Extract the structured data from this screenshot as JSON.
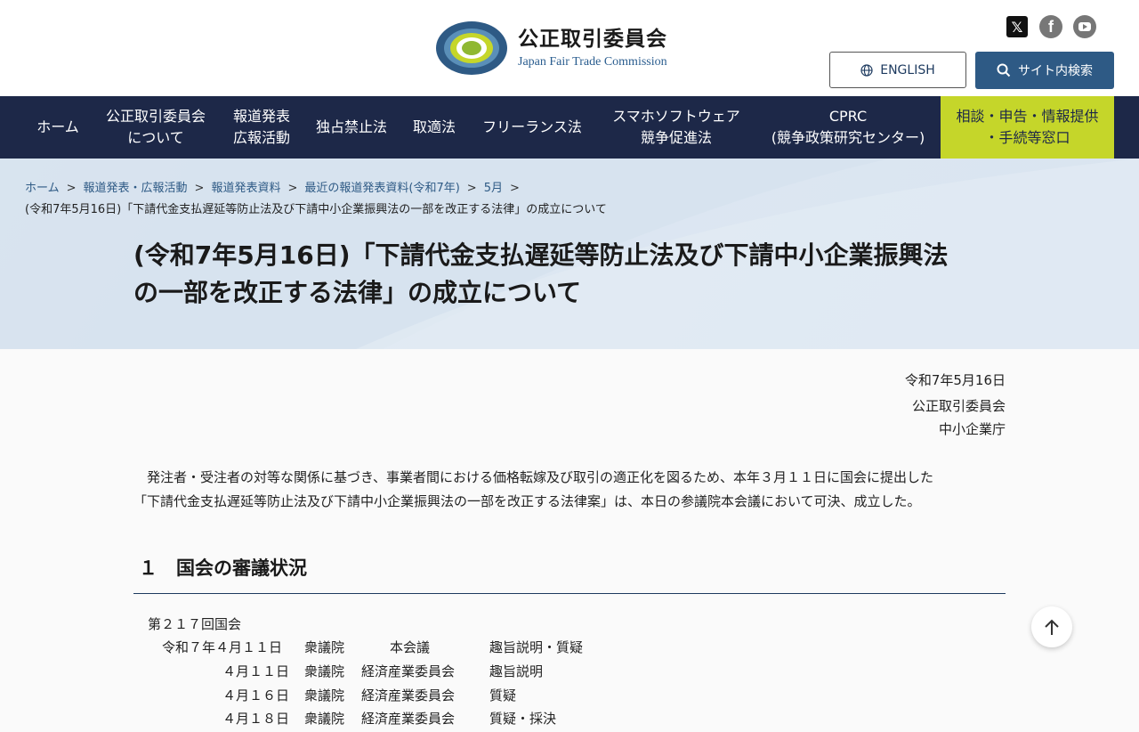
{
  "header": {
    "org_name_ja": "公正取引委員会",
    "org_name_en": "Japan Fair Trade Commission",
    "logo_ring_text": "JAPAN FAIR TRADE COMMISSION",
    "english_label": "ENGLISH",
    "search_label": "サイト内検索",
    "social": [
      "x-icon",
      "facebook-icon",
      "youtube-icon"
    ]
  },
  "nav": {
    "items": [
      "ホーム",
      "公正取引委員会\nについて",
      "報道発表\n広報活動",
      "独占禁止法",
      "取適法",
      "フリーランス法",
      "スマホソフトウェア\n競争促進法",
      "CPRC\n(競争政策研究センター)",
      "相談・申告・情報提供\n・手続等窓口"
    ]
  },
  "breadcrumb": {
    "items": [
      "ホーム",
      "報道発表・広報活動",
      "報道発表資料",
      "最近の報道発表資料(令和7年)",
      "5月"
    ],
    "separator": ">",
    "current": "(令和7年5月16日)「下請代金支払遅延等防止法及び下請中小企業振興法の一部を改正する法律」の成立について"
  },
  "page": {
    "title_line1": "(令和7年5月16日)「下請代金支払遅延等防止法及び下請中小企業振興法",
    "title_line2": "の一部を改正する法律」の成立について",
    "date": "令和7年5月16日",
    "issuer1": "公正取引委員会",
    "issuer2": "中小企業庁",
    "para_line1": "　発注者・受注者の対等な関係に基づき、事業者間における価格転嫁及び取引の適正化を図るため、本年３月１１日に国会に提出した",
    "para_line2": "「下請代金支払遅延等防止法及び下請中小企業振興法の一部を改正する法律案」は、本日の参議院本会議において可決、成立した。",
    "section1_heading": "１　国会の審議状況",
    "deliberation_title": "第２１７回国会",
    "deliberation_rows": [
      {
        "date": "令和７年４月１１日",
        "house": "衆議院",
        "committee": "本会議",
        "action": "趣旨説明・質疑"
      },
      {
        "date": "４月１１日",
        "house": "衆議院",
        "committee": "経済産業委員会",
        "action": "趣旨説明"
      },
      {
        "date": "４月１６日",
        "house": "衆議院",
        "committee": "経済産業委員会",
        "action": "質疑"
      },
      {
        "date": "４月１８日",
        "house": "衆議院",
        "committee": "経済産業委員会",
        "action": "質疑・採決"
      }
    ]
  },
  "colors": {
    "nav_bg": "#1d2848",
    "consult_bg": "#c5d62a",
    "search_btn_bg": "#2e5a85",
    "link": "#2e5a85"
  }
}
